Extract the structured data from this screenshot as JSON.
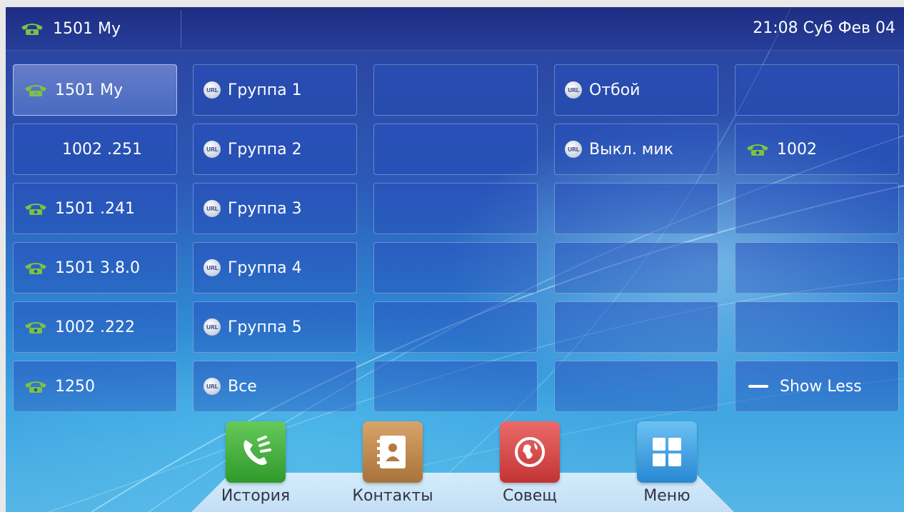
{
  "status_bar": {
    "account": "1501 My",
    "datetime": "21:08 Суб Фев 04"
  },
  "grid": {
    "col1": [
      "1501 My",
      "1002 .251",
      "1501 .241",
      "1501 3.8.0",
      "1002 .222",
      "1250"
    ],
    "col2": [
      "Группа 1",
      "Группа 2",
      "Группа 3",
      "Группа 4",
      "Группа 5",
      "Все"
    ],
    "col4": [
      "Отбой",
      "Выкл. мик"
    ],
    "col5": [
      "1002",
      "Show Less"
    ],
    "url_badge": "URL"
  },
  "dock": {
    "items": [
      {
        "label": "История",
        "color": "#3ea83a",
        "icon": "call-history-icon"
      },
      {
        "label": "Контакты",
        "color": "#c08a4e",
        "icon": "contacts-book-icon"
      },
      {
        "label": "Совещ",
        "color": "#d54444",
        "icon": "globe-conference-icon"
      },
      {
        "label": "Меню",
        "color": "#2f9be0",
        "icon": "menu-grid-icon"
      }
    ]
  },
  "colors": {
    "phone_icon": "#7cc242",
    "accent_bg": "#2c5ab8"
  }
}
